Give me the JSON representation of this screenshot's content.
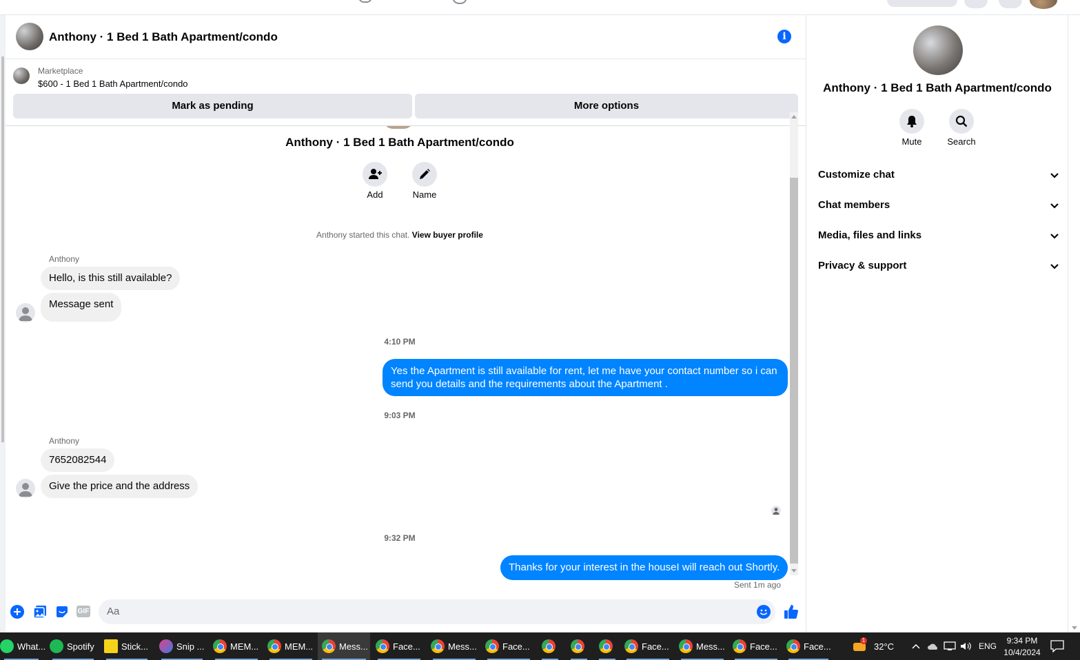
{
  "header": {
    "title": "Anthony · 1 Bed 1 Bath Apartment/condo"
  },
  "marketplace": {
    "label": "Marketplace",
    "item": "$600 - 1 Bed 1 Bath Apartment/condo",
    "pending_button": "Mark as pending",
    "more_button": "More options"
  },
  "thread": {
    "name": "Anthony · 1 Bed 1 Bath Apartment/condo",
    "add_label": "Add",
    "name_label": "Name",
    "started": "Anthony started this chat.",
    "view_profile": "View buyer profile",
    "messages": [
      {
        "sender": "Anthony",
        "text": "Hello, is this still available?"
      },
      {
        "text": "Message sent"
      },
      {
        "time": "4:10 PM"
      },
      {
        "text": "Yes the Apartment is still available for rent, let me have your contact number so i can send you details and the requirements about the Apartment ."
      },
      {
        "time": "9:03 PM"
      },
      {
        "sender": "Anthony",
        "text": "7652082544"
      },
      {
        "text": "Give the price and the address"
      },
      {
        "time": "9:32 PM"
      },
      {
        "text": "Thanks for your interest in the houseI will reach out Shortly."
      }
    ],
    "sent_status": "Sent 1m ago"
  },
  "composer": {
    "placeholder": "Aa"
  },
  "details": {
    "name": "Anthony · 1 Bed 1 Bath Apartment/condo",
    "mute": "Mute",
    "search": "Search",
    "rows": [
      "Customize chat",
      "Chat members",
      "Media, files and links",
      "Privacy & support"
    ]
  },
  "taskbar": {
    "items": [
      "What...",
      "Spotify",
      "Stick...",
      "Snip ...",
      "MEM...",
      "MEM...",
      "Mess...",
      "Face...",
      "Mess...",
      "Face...",
      "Face...",
      "Mess...",
      "Face...",
      "Face..."
    ],
    "temperature": "32°C",
    "weather_badge": "1",
    "language": "ENG",
    "time": "9:34 PM",
    "date": "10/4/2024"
  },
  "colors": {
    "accent": "#0084ff",
    "brand": "#0866ff",
    "bubble_in": "#f0f0f0",
    "button_gray": "#e4e6eb"
  }
}
